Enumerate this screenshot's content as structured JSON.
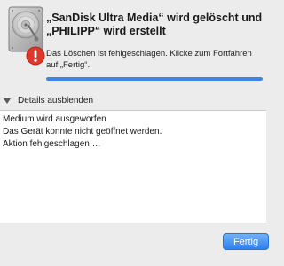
{
  "dialog": {
    "title": "„SanDisk Ultra Media“ wird gelöscht und „PHILIPP“ wird erstellt",
    "message": "Das Löschen ist fehlgeschlagen. Klicke zum Fortfahren auf „Fertig“.",
    "progress_fraction": 1.0,
    "accent_color": "#3d84e8",
    "disk_icon": "hard-disk-icon",
    "warning_icon": "warning-badge-icon"
  },
  "details": {
    "toggle_label": "Details ausblenden",
    "log_lines": [
      "Medium wird ausgeworfen",
      "Das Gerät konnte nicht geöffnet werden.",
      "Aktion fehlgeschlagen …"
    ]
  },
  "buttons": {
    "done_label": "Fertig"
  }
}
